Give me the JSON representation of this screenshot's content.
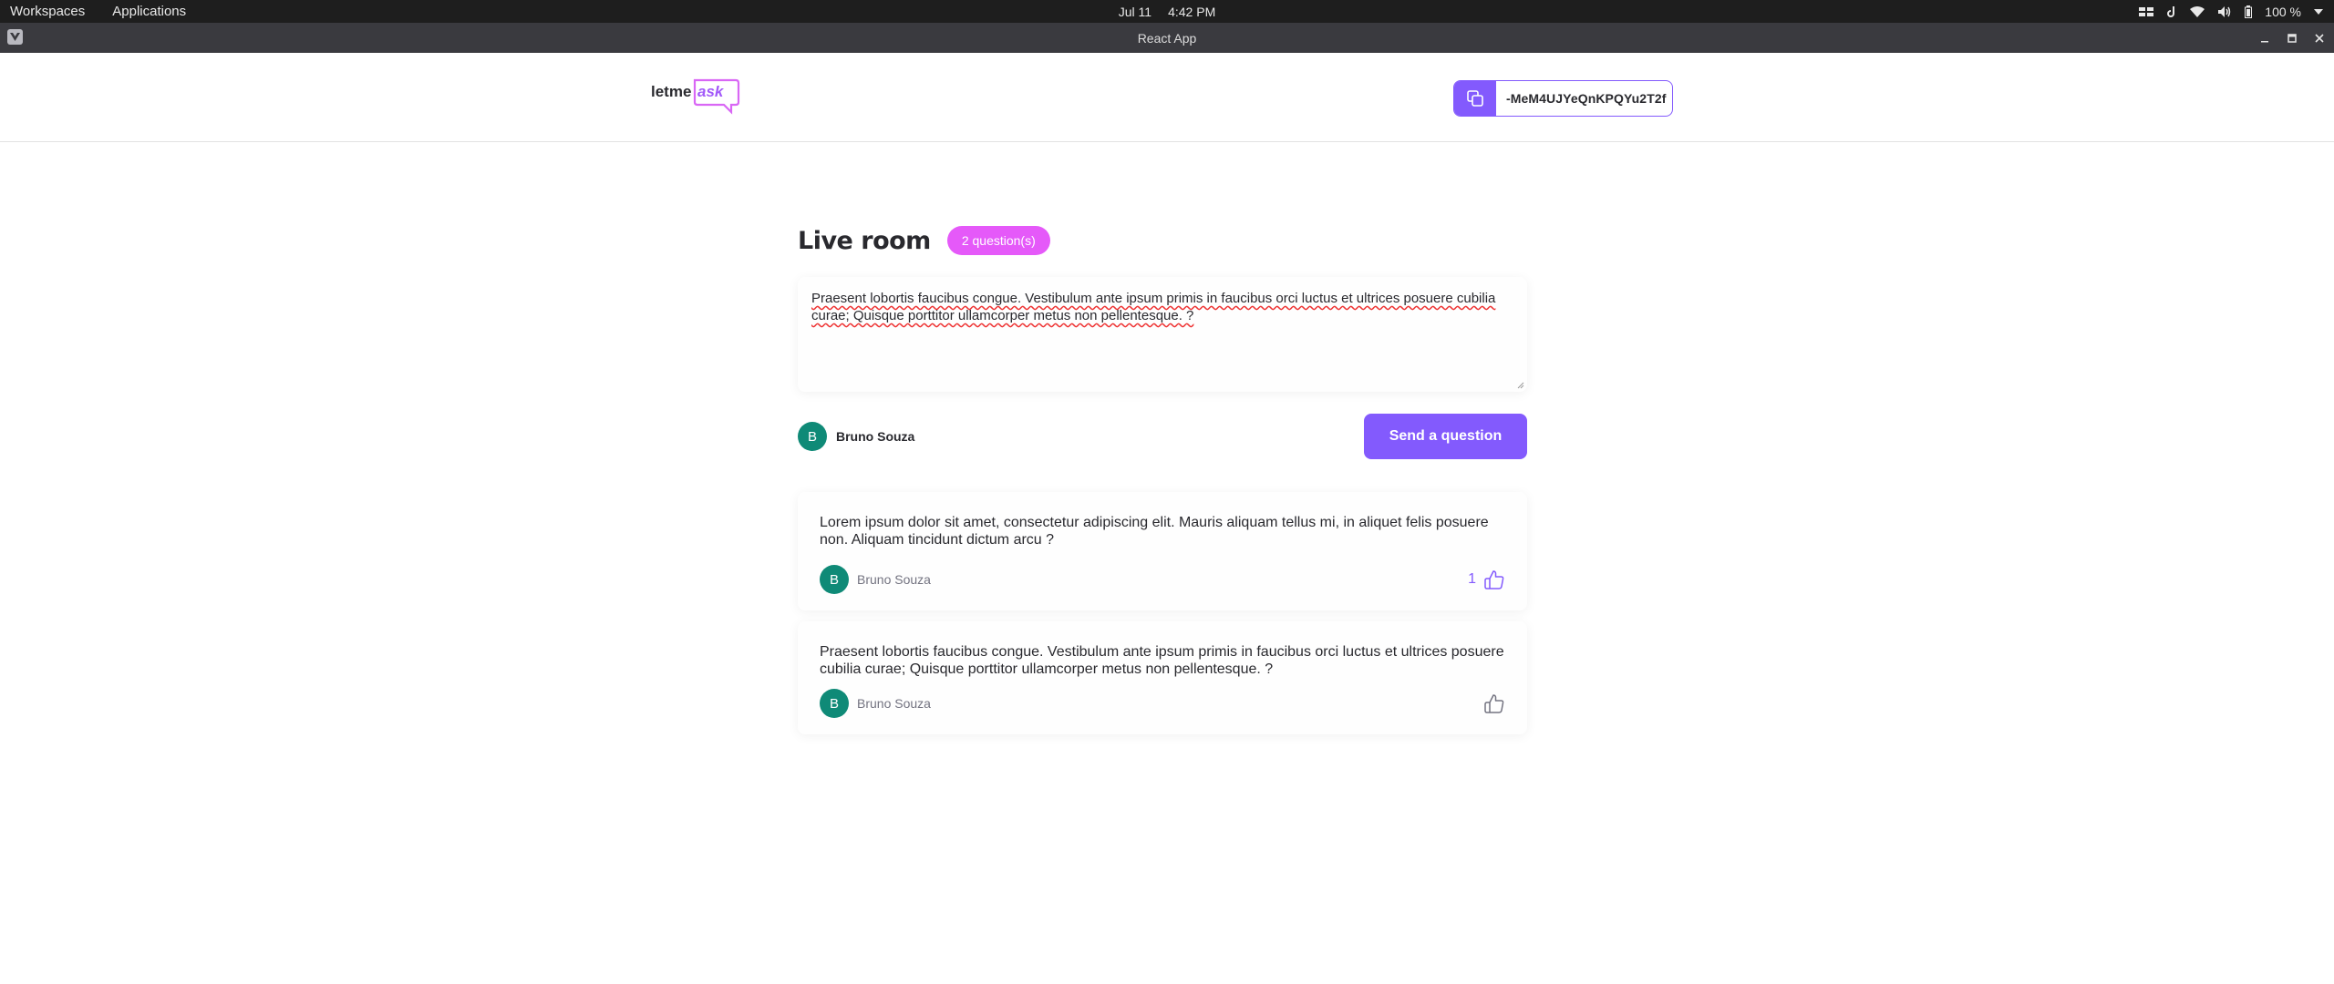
{
  "system": {
    "workspaces": "Workspaces",
    "applications": "Applications",
    "date": "Jul 11",
    "time": "4:42 PM",
    "battery": "100 %"
  },
  "window": {
    "title": "React App"
  },
  "header": {
    "logo_text_a": "letme",
    "logo_text_b": "ask",
    "room_code": "-MeM4UJYeQnKPQYu2T2f"
  },
  "room": {
    "title": "Live room",
    "badge": "2 question(s)"
  },
  "form": {
    "textarea_value": "Praesent lobortis faucibus congue. Vestibulum ante ipsum primis in faucibus orci luctus et ultrices posuere cubilia curae; Quisque porttitor ullamcorper metus non pellentesque.  ?",
    "user_initial": "B",
    "user_name": "Bruno Souza",
    "send_label": "Send a question"
  },
  "questions": [
    {
      "text": "Lorem ipsum dolor sit amet, consectetur adipiscing elit. Mauris aliquam tellus mi, in aliquet felis posuere non. Aliquam tincidunt dictum arcu ?",
      "author_initial": "B",
      "author": "Bruno Souza",
      "likes": "1"
    },
    {
      "text": "Praesent lobortis faucibus congue. Vestibulum ante ipsum primis in faucibus orci luctus et ultrices posuere cubilia curae; Quisque porttitor ullamcorper metus non pellentesque. ?",
      "author_initial": "B",
      "author": "Bruno Souza",
      "likes": ""
    }
  ],
  "colors": {
    "accent": "#835afd",
    "badge": "#e559f9",
    "avatar": "#0f8a77"
  }
}
